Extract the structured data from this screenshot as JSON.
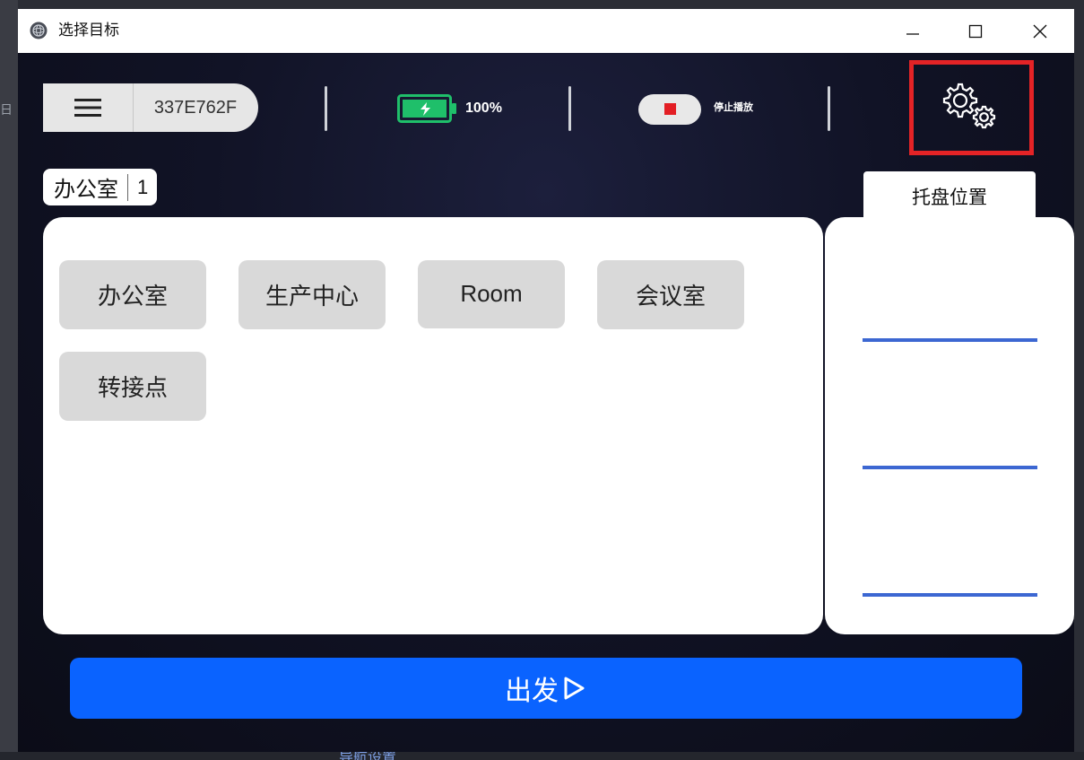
{
  "window": {
    "title": "选择目标",
    "controls": {
      "minimize": "—",
      "maximize": "☐",
      "close": "✕"
    }
  },
  "topbar": {
    "menu_icon": "hamburger-icon",
    "device_id": "337E762F",
    "battery": {
      "percent_label": "100%",
      "level": 1.0,
      "color": "#1fbf6a"
    },
    "stop": {
      "label": "停止播放",
      "color": "#e31e24"
    },
    "settings_icon": "gears-icon",
    "highlight_color": "#e42326"
  },
  "current_area": {
    "name": "办公室",
    "number": "1"
  },
  "targets": [
    "办公室",
    "生产中心",
    "Room",
    "会议室",
    "转接点"
  ],
  "tray": {
    "tab_label": "托盘位置",
    "slots": 3,
    "line_color": "#3c67d2"
  },
  "go_button": {
    "label": "出发",
    "icon": "play-outline-icon",
    "color": "#0a63ff"
  },
  "background": {
    "side_glyph": "日",
    "bottom_text": "导航设置"
  }
}
